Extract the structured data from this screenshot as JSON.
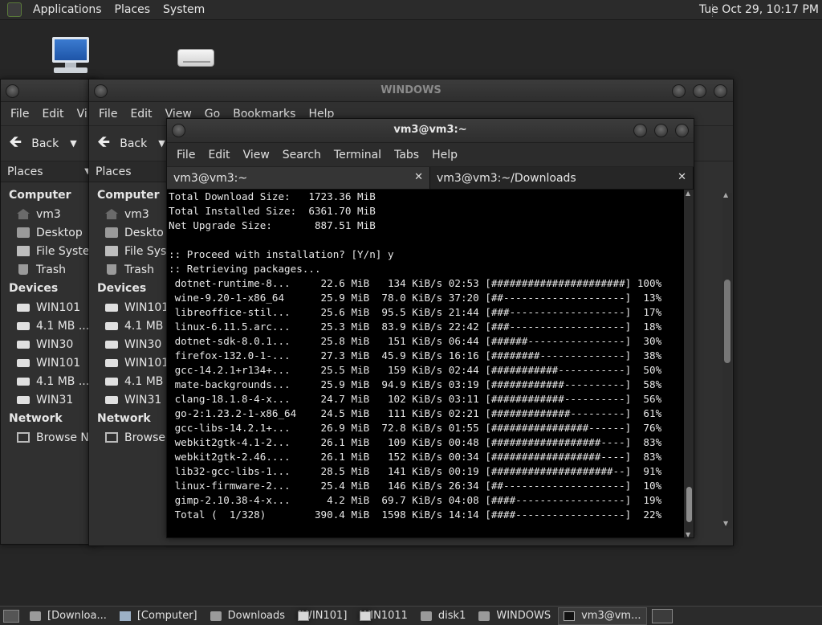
{
  "top_panel": {
    "menus": [
      "Applications",
      "Places",
      "System"
    ],
    "clock": "Tue Oct 29, 10:17 PM"
  },
  "file_manager_back": {
    "menus": [
      "File",
      "Edit",
      "Vi"
    ],
    "back_label": "Back",
    "places_label": "Places",
    "sections": {
      "computer": "Computer",
      "devices": "Devices",
      "network": "Network"
    },
    "computer_items": [
      "vm3",
      "Desktop",
      "File Syste",
      "Trash"
    ],
    "device_items": [
      "WIN101",
      "4.1 MB ...",
      "WIN30",
      "WIN101",
      "4.1 MB ...",
      "WIN31"
    ],
    "network_items": [
      "Browse Ne"
    ]
  },
  "file_manager_front": {
    "title": "WINDOWS",
    "menus": [
      "File",
      "Edit",
      "View",
      "Go",
      "Bookmarks",
      "Help"
    ],
    "back_label": "Back",
    "places_label": "Places",
    "sections": {
      "computer": "Computer",
      "devices": "Devices",
      "network": "Network"
    },
    "computer_items": [
      "vm3",
      "Deskto",
      "File Sys",
      "Trash"
    ],
    "device_items": [
      "WIN101",
      "4.1 MB",
      "WIN30",
      "WIN101",
      "4.1 MB",
      "WIN31"
    ],
    "network_items": [
      "Browse"
    ]
  },
  "terminal": {
    "title": "vm3@vm3:~",
    "menus": [
      "File",
      "Edit",
      "View",
      "Search",
      "Terminal",
      "Tabs",
      "Help"
    ],
    "tabs": [
      {
        "label": "vm3@vm3:~",
        "close": "✕"
      },
      {
        "label": "vm3@vm3:~/Downloads",
        "close": "✕"
      }
    ],
    "lines": [
      "Total Download Size:   1723.36 MiB",
      "Total Installed Size:  6361.70 MiB",
      "Net Upgrade Size:       887.51 MiB",
      "",
      ":: Proceed with installation? [Y/n] y",
      ":: Retrieving packages...",
      " dotnet-runtime-8...     22.6 MiB   134 KiB/s 02:53 [######################] 100%",
      " wine-9.20-1-x86_64      25.9 MiB  78.0 KiB/s 37:20 [##--------------------]  13%",
      " libreoffice-stil...     25.6 MiB  95.5 KiB/s 21:44 [###-------------------]  17%",
      " linux-6.11.5.arc...     25.3 MiB  83.9 KiB/s 22:42 [###-------------------]  18%",
      " dotnet-sdk-8.0.1...     25.8 MiB   151 KiB/s 06:44 [######----------------]  30%",
      " firefox-132.0-1-...     27.3 MiB  45.9 KiB/s 16:16 [########--------------]  38%",
      " gcc-14.2.1+r134+...     25.5 MiB   159 KiB/s 02:44 [###########-----------]  50%",
      " mate-backgrounds...     25.9 MiB  94.9 KiB/s 03:19 [############----------]  58%",
      " clang-18.1.8-4-x...     24.7 MiB   102 KiB/s 03:11 [############----------]  56%",
      " go-2:1.23.2-1-x86_64    24.5 MiB   111 KiB/s 02:21 [#############---------]  61%",
      " gcc-libs-14.2.1+...     26.9 MiB  72.8 KiB/s 01:55 [################------]  76%",
      " webkit2gtk-4.1-2...     26.1 MiB   109 KiB/s 00:48 [##################----]  83%",
      " webkit2gtk-2.46....     26.1 MiB   152 KiB/s 00:34 [##################----]  83%",
      " lib32-gcc-libs-1...     28.5 MiB   141 KiB/s 00:19 [####################--]  91%",
      " linux-firmware-2...     25.4 MiB   146 KiB/s 26:34 [##--------------------]  10%",
      " gimp-2.10.38-4-x...      4.2 MiB  69.7 KiB/s 04:08 [####------------------]  19%",
      " Total (  1/328)        390.4 MiB  1598 KiB/s 14:14 [####------------------]  22%"
    ]
  },
  "taskbar": {
    "tasks": [
      {
        "label": "[Downloa...",
        "icon": "folder-icon"
      },
      {
        "label": "[Computer]",
        "icon": "computer-icon"
      },
      {
        "label": "Downloads",
        "icon": "folder-icon"
      },
      {
        "label": "[WIN101]",
        "icon": "drive-icon"
      },
      {
        "label": "WIN1011",
        "icon": "drive-icon"
      },
      {
        "label": "disk1",
        "icon": "folder-icon"
      },
      {
        "label": "WINDOWS",
        "icon": "folder-icon"
      },
      {
        "label": "vm3@vm...",
        "icon": "terminal-icon",
        "active": true
      }
    ]
  }
}
